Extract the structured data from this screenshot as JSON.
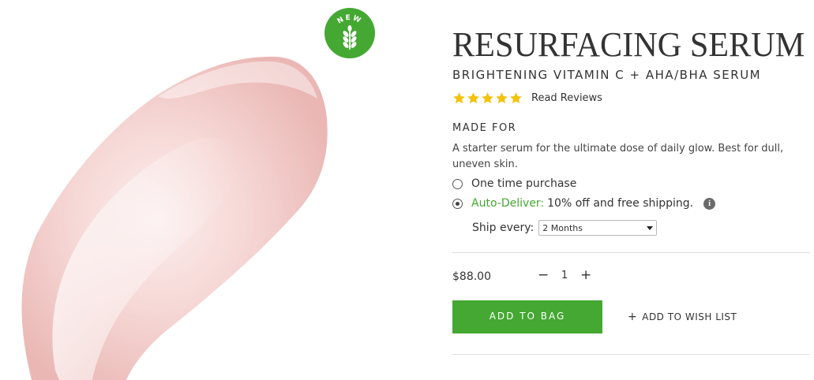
{
  "badge": {
    "text": "NEW",
    "icon": "wheat-icon",
    "color": "#44a832"
  },
  "product": {
    "title": "RESURFACING SERUM",
    "subtitle": "BRIGHTENING VITAMIN C + AHA/BHA SERUM",
    "rating": {
      "stars": 5,
      "max": 5,
      "star_color": "#f4c20d"
    },
    "read_reviews_label": "Read Reviews",
    "made_for_heading": "MADE FOR",
    "made_for_text": "A starter serum for the ultimate dose of daily glow. Best for dull, uneven skin."
  },
  "purchase": {
    "one_time_label": "One time purchase",
    "auto_deliver_label": "Auto-Deliver:",
    "auto_deliver_desc": "10% off and free shipping.",
    "info_icon": "i",
    "selected": "auto-deliver",
    "ship_every_label": "Ship every:",
    "ship_every_value": "2 Months"
  },
  "cart": {
    "price": "$88.00",
    "qty_minus": "−",
    "qty_value": "1",
    "qty_plus": "+",
    "add_to_bag_label": "ADD TO BAG",
    "wish_list_plus": "+",
    "wish_list_label": "ADD TO WISH LIST"
  },
  "colors": {
    "accent_green": "#44a832",
    "text": "#333333",
    "swatch_pink": "#f2c9c6"
  }
}
